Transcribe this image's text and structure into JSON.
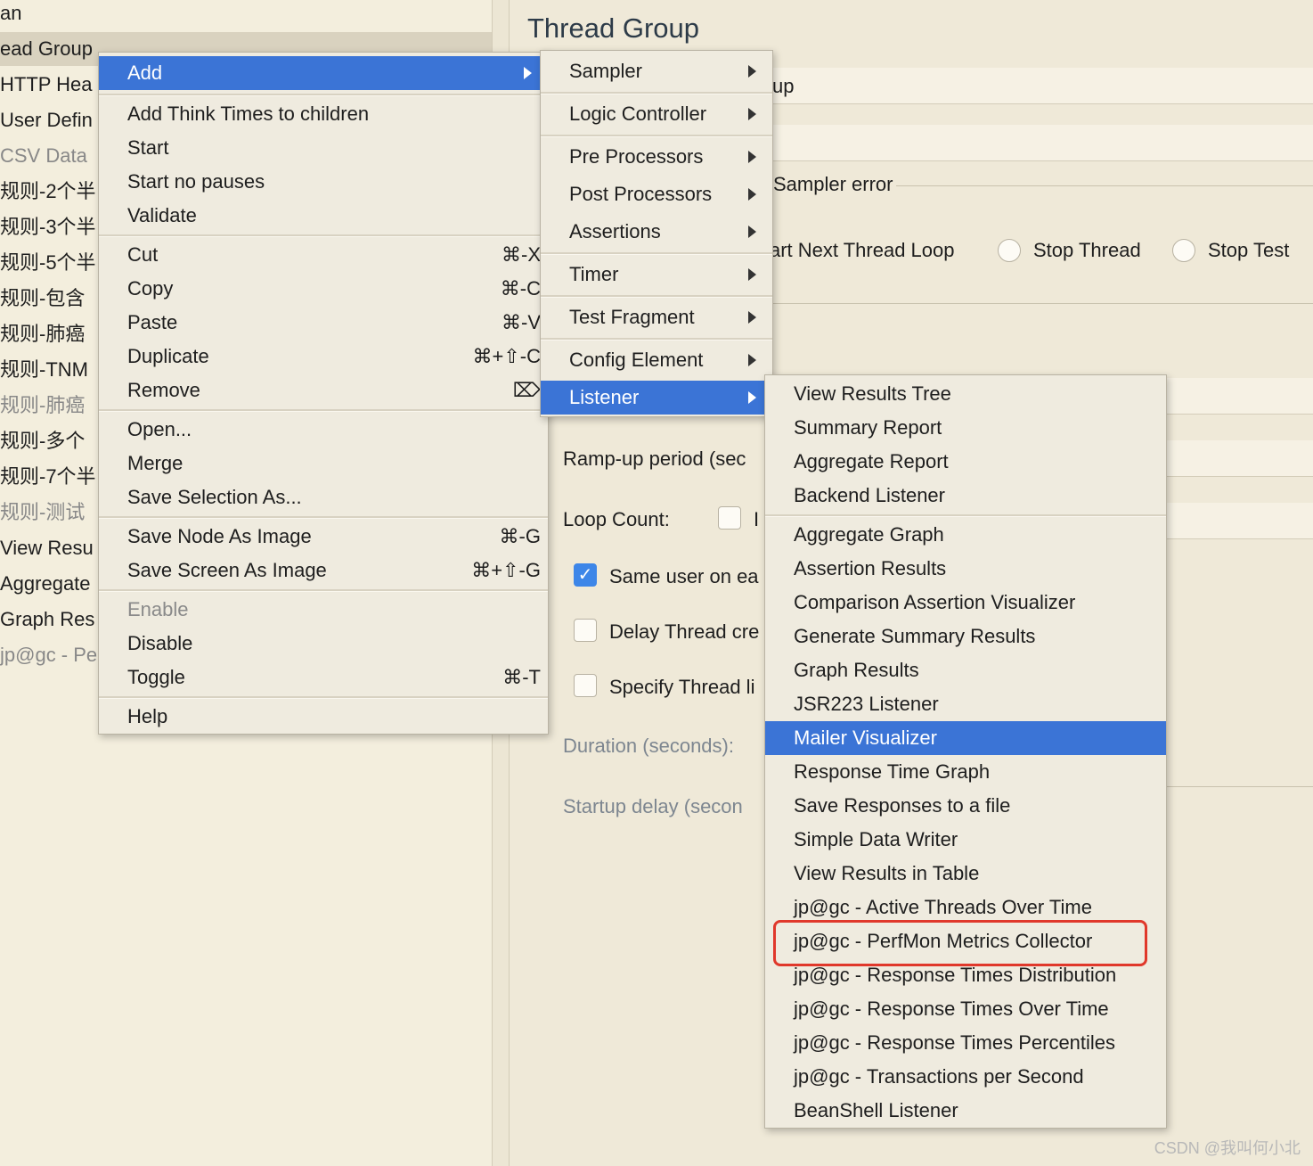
{
  "tree": {
    "items": [
      {
        "label": "an",
        "dim": false
      },
      {
        "label": "ead Group",
        "dim": false
      },
      {
        "label": "HTTP Hea",
        "dim": false
      },
      {
        "label": "User Defin",
        "dim": false
      },
      {
        "label": "CSV Data",
        "dim": true
      },
      {
        "label": "规则-2个半",
        "dim": false
      },
      {
        "label": "规则-3个半",
        "dim": false
      },
      {
        "label": "规则-5个半",
        "dim": false
      },
      {
        "label": "规则-包含",
        "dim": false
      },
      {
        "label": "规则-肺癌",
        "dim": false
      },
      {
        "label": "规则-TNM",
        "dim": false
      },
      {
        "label": "规则-肺癌",
        "dim": true
      },
      {
        "label": "规则-多个",
        "dim": false
      },
      {
        "label": "规则-7个半",
        "dim": false
      },
      {
        "label": "规则-测试",
        "dim": true
      },
      {
        "label": "View Resu",
        "dim": false
      },
      {
        "label": "Aggregate",
        "dim": false
      },
      {
        "label": "Graph Res",
        "dim": false
      },
      {
        "label": "jp@gc - Pe",
        "dim": true
      }
    ]
  },
  "panel": {
    "title": "Thread Group",
    "name_fragment": "up",
    "sampler_error_label": "Sampler error",
    "action_next_loop": "art Next Thread Loop",
    "action_stop_thread": "Stop Thread",
    "action_stop_test": "Stop Test",
    "rampup_label": "Ramp-up period (sec",
    "loop_count_label": "Loop Count:",
    "loop_infinite_fragment": "I",
    "same_user_label": "Same user on ea",
    "same_user_checked": true,
    "delay_thread_label": "Delay Thread cre",
    "specify_thread_label": "Specify Thread li",
    "duration_label": "Duration (seconds):",
    "startup_delay_label": "Startup delay (secon"
  },
  "context_menu": {
    "items": [
      {
        "label": "Add",
        "shortcut": "",
        "submenu": true,
        "selected": true
      },
      {
        "label": "Add Think Times to children",
        "shortcut": ""
      },
      {
        "label": "Start",
        "shortcut": ""
      },
      {
        "label": "Start no pauses",
        "shortcut": ""
      },
      {
        "label": "Validate",
        "shortcut": ""
      },
      {
        "label": "Cut",
        "shortcut": "⌘-X"
      },
      {
        "label": "Copy",
        "shortcut": "⌘-C"
      },
      {
        "label": "Paste",
        "shortcut": "⌘-V"
      },
      {
        "label": "Duplicate",
        "shortcut": "⌘+⇧-C"
      },
      {
        "label": "Remove",
        "shortcut": "⌦"
      },
      {
        "label": "Open...",
        "shortcut": ""
      },
      {
        "label": "Merge",
        "shortcut": ""
      },
      {
        "label": "Save Selection As...",
        "shortcut": ""
      },
      {
        "label": "Save Node As Image",
        "shortcut": "⌘-G"
      },
      {
        "label": "Save Screen As Image",
        "shortcut": "⌘+⇧-G"
      },
      {
        "label": "Enable",
        "shortcut": "",
        "disabled": true
      },
      {
        "label": "Disable",
        "shortcut": ""
      },
      {
        "label": "Toggle",
        "shortcut": "⌘-T"
      },
      {
        "label": "Help",
        "shortcut": ""
      }
    ]
  },
  "add_submenu": {
    "items": [
      {
        "label": "Sampler"
      },
      {
        "label": "Logic Controller"
      },
      {
        "label": "Pre Processors"
      },
      {
        "label": "Post Processors"
      },
      {
        "label": "Assertions"
      },
      {
        "label": "Timer"
      },
      {
        "label": "Test Fragment"
      },
      {
        "label": "Config Element"
      },
      {
        "label": "Listener",
        "selected": true
      }
    ]
  },
  "listener_submenu": {
    "items": [
      {
        "label": "View Results Tree"
      },
      {
        "label": "Summary Report"
      },
      {
        "label": "Aggregate Report"
      },
      {
        "label": "Backend Listener"
      },
      {
        "label": "Aggregate Graph"
      },
      {
        "label": "Assertion Results"
      },
      {
        "label": "Comparison Assertion Visualizer"
      },
      {
        "label": "Generate Summary Results"
      },
      {
        "label": "Graph Results"
      },
      {
        "label": "JSR223 Listener"
      },
      {
        "label": "Mailer Visualizer",
        "selected": true
      },
      {
        "label": "Response Time Graph"
      },
      {
        "label": "Save Responses to a file"
      },
      {
        "label": "Simple Data Writer"
      },
      {
        "label": "View Results in Table"
      },
      {
        "label": "jp@gc - Active Threads Over Time"
      },
      {
        "label": "jp@gc - PerfMon Metrics Collector",
        "annotated": true
      },
      {
        "label": "jp@gc - Response Times Distribution"
      },
      {
        "label": "jp@gc - Response Times Over Time"
      },
      {
        "label": "jp@gc - Response Times Percentiles"
      },
      {
        "label": "jp@gc - Transactions per Second"
      },
      {
        "label": "BeanShell Listener"
      }
    ]
  },
  "annotation_color": "#e0382b",
  "selection_color": "#3b74d6",
  "watermark": "CSDN @我叫何小北"
}
